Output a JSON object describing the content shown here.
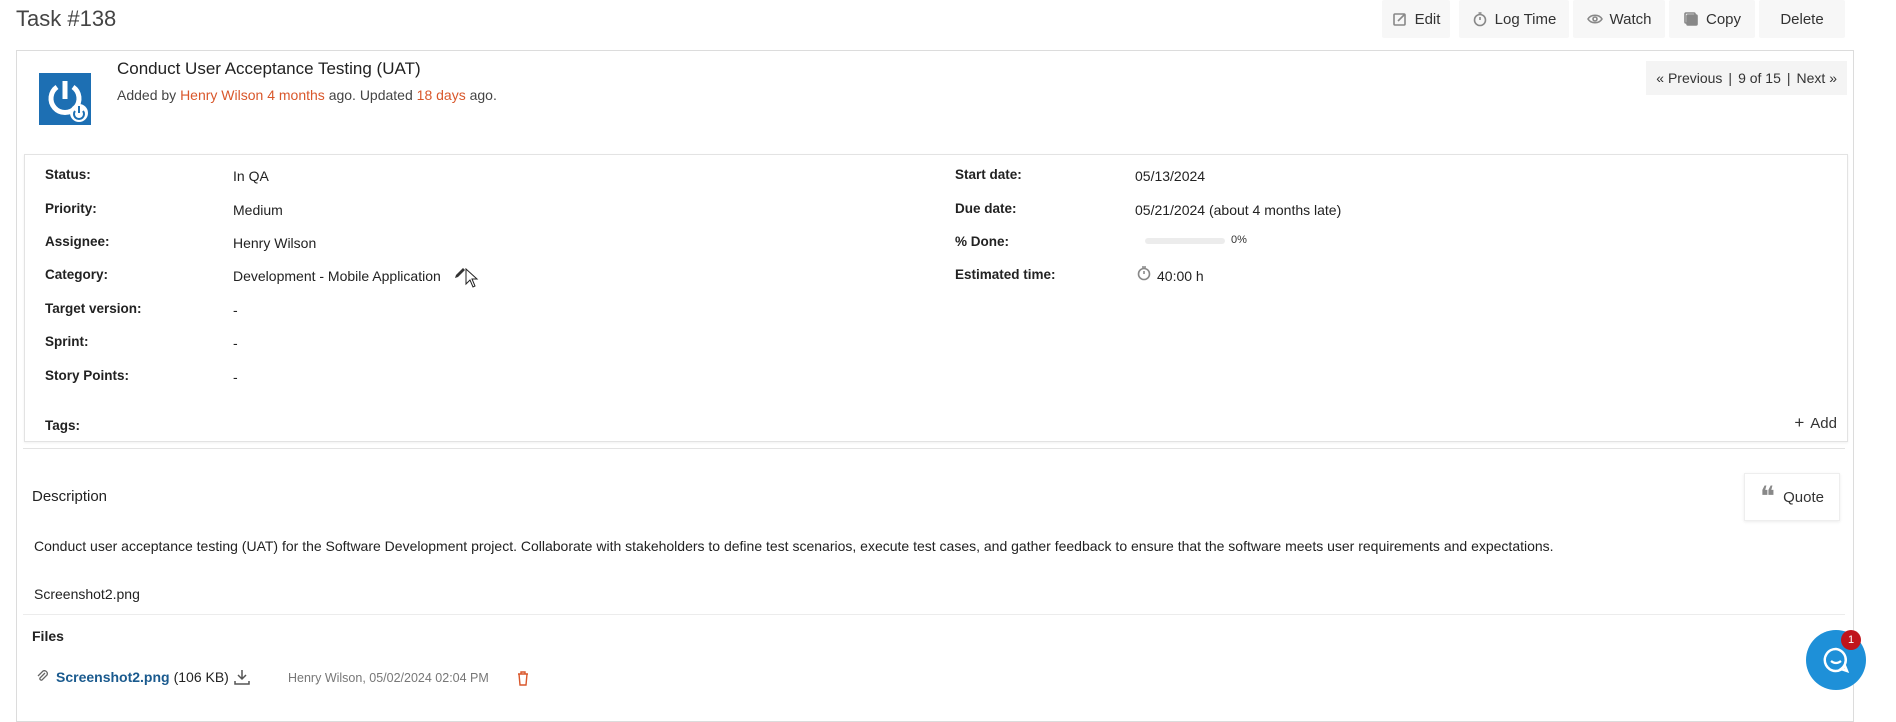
{
  "header": {
    "title": "Task #138",
    "toolbar": {
      "edit": "Edit",
      "log_time": "Log Time",
      "watch": "Watch",
      "copy": "Copy",
      "delete": "Delete"
    }
  },
  "task": {
    "subject": "Conduct User Acceptance Testing (UAT)",
    "byline": {
      "added_by_prefix": "Added by",
      "author": "Henry Wilson",
      "created_ago": "4 months",
      "ago_updated": "ago. Updated",
      "updated_ago": "18 days",
      "suffix": "ago."
    },
    "pager": {
      "previous": "« Previous",
      "sep1": "|",
      "position": "9 of 15",
      "sep2": "|",
      "next": "Next »"
    }
  },
  "attributes": {
    "left": [
      {
        "label": "Status:",
        "value": "In QA"
      },
      {
        "label": "Priority:",
        "value": "Medium"
      },
      {
        "label": "Assignee:",
        "value": "Henry Wilson"
      },
      {
        "label": "Category:",
        "value": "Development - Mobile Application"
      },
      {
        "label": "Target version:",
        "value": "-"
      },
      {
        "label": "Sprint:",
        "value": "-"
      },
      {
        "label": "Story Points:",
        "value": "-"
      }
    ],
    "right": [
      {
        "label": "Start date:",
        "value": "05/13/2024"
      },
      {
        "label": "Due date:",
        "value": "05/21/2024 (about 4 months late)"
      },
      {
        "label": "% Done:",
        "value": "0%",
        "progress_fraction": 0
      },
      {
        "label": "Estimated time:",
        "value": "40:00 h"
      }
    ],
    "tags_label": "Tags:",
    "add_tag": "Add"
  },
  "description": {
    "heading": "Description",
    "quote_button": "Quote",
    "text": "Conduct user acceptance testing (UAT) for the Software Development project. Collaborate with stakeholders to define test scenarios, execute test cases, and gather feedback to ensure that the software meets user requirements and expectations.",
    "attachment_ref": "Screenshot2.png"
  },
  "files": {
    "heading": "Files",
    "items": [
      {
        "name": "Screenshot2.png",
        "size": "(106 KB)",
        "meta": "Henry Wilson, 05/02/2024 02:04 PM"
      }
    ]
  },
  "chat": {
    "badge_count": "1"
  },
  "colors": {
    "accent_link": "#d9572b",
    "file_link": "#1a5a8e",
    "chat": "#1e90d8",
    "badge": "#c0141c",
    "avatar": "#1d6fb3"
  },
  "icons": [
    "edit-icon",
    "stopwatch-icon",
    "eye-icon",
    "copy-icon",
    "pencil-icon",
    "plus-icon",
    "quote-icon",
    "paperclip-icon",
    "download-icon",
    "trash-icon",
    "chat-icon"
  ]
}
